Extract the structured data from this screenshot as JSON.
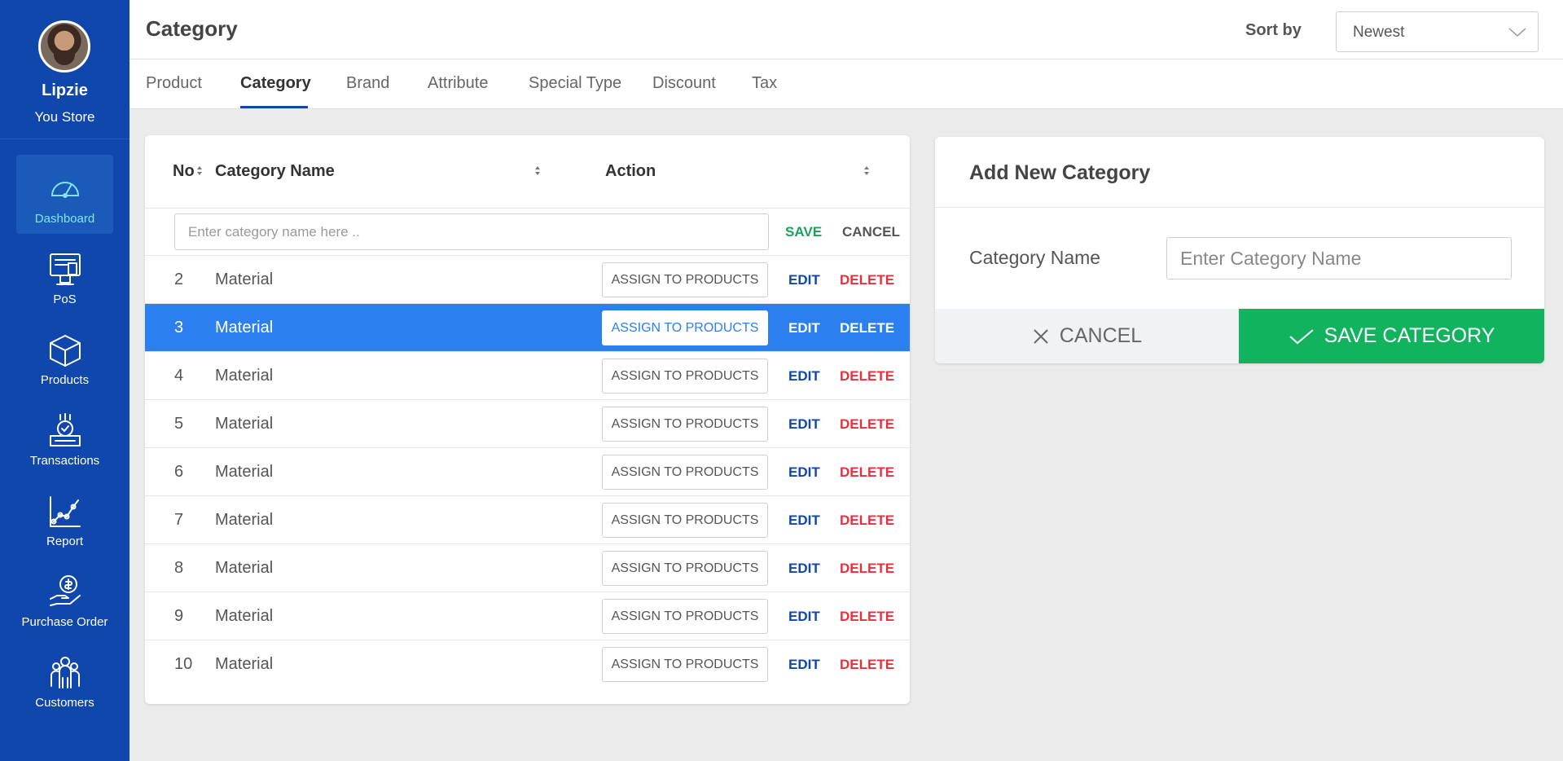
{
  "sidebar": {
    "user_name": "Lipzie",
    "store_name": "You Store",
    "items": [
      {
        "label": "Dashboard",
        "icon": "dashboard-icon",
        "active": true
      },
      {
        "label": "PoS",
        "icon": "pos-icon",
        "active": false
      },
      {
        "label": "Products",
        "icon": "box-icon",
        "active": false
      },
      {
        "label": "Transactions",
        "icon": "transactions-icon",
        "active": false
      },
      {
        "label": "Report",
        "icon": "report-icon",
        "active": false
      },
      {
        "label": "Purchase Order",
        "icon": "purchase-order-icon",
        "active": false
      },
      {
        "label": "Customers",
        "icon": "customers-icon",
        "active": false
      }
    ]
  },
  "header": {
    "title": "Category",
    "sort_label": "Sort by",
    "sort_value": "Newest"
  },
  "tabs": [
    {
      "label": "Product",
      "active": false
    },
    {
      "label": "Category",
      "active": true
    },
    {
      "label": "Brand",
      "active": false
    },
    {
      "label": "Attribute",
      "active": false
    },
    {
      "label": "Special Type",
      "active": false
    },
    {
      "label": "Discount",
      "active": false
    },
    {
      "label": "Tax",
      "active": false
    }
  ],
  "table": {
    "columns": {
      "no": "No",
      "name": "Category Name",
      "action": "Action"
    },
    "new_row": {
      "placeholder": "Enter category name here ..",
      "save_label": "SAVE",
      "cancel_label": "CANCEL"
    },
    "assign_label": "ASSIGN TO PRODUCTS",
    "edit_label": "EDIT",
    "delete_label": "DELETE",
    "rows": [
      {
        "no": "2",
        "name": "Material",
        "selected": false
      },
      {
        "no": "3",
        "name": "Material",
        "selected": true
      },
      {
        "no": "4",
        "name": "Material",
        "selected": false
      },
      {
        "no": "5",
        "name": "Material",
        "selected": false
      },
      {
        "no": "6",
        "name": "Material",
        "selected": false
      },
      {
        "no": "7",
        "name": "Material",
        "selected": false
      },
      {
        "no": "8",
        "name": "Material",
        "selected": false
      },
      {
        "no": "9",
        "name": "Material",
        "selected": false
      },
      {
        "no": "10",
        "name": "Material",
        "selected": false
      }
    ]
  },
  "add_form": {
    "title": "Add New Category",
    "field_label": "Category Name",
    "field_placeholder": "Enter Category Name",
    "cancel_label": "CANCEL",
    "save_label": "SAVE CATEGORY"
  },
  "colors": {
    "sidebar": "#0f47ad",
    "selected_row": "#2b7fef",
    "save_green": "#12b35f",
    "delete_red": "#e6303f",
    "active_nav_text": "#7fe6ff"
  }
}
